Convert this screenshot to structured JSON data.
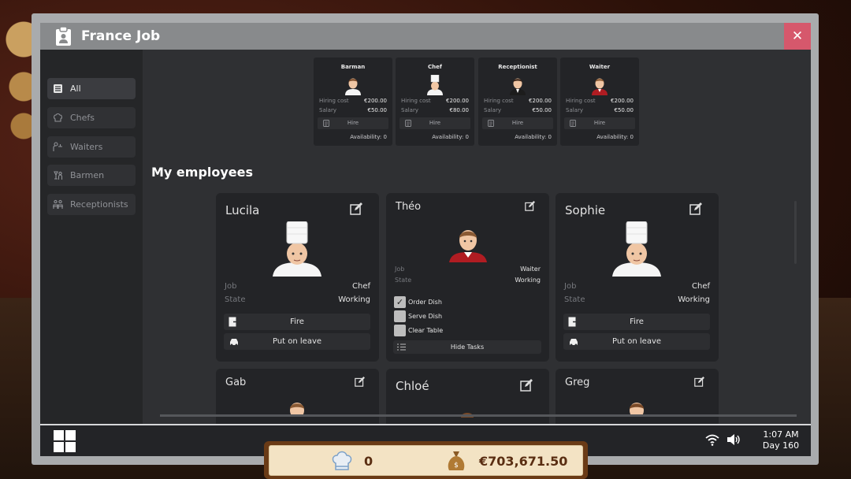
{
  "window": {
    "title": "France Job",
    "close": "✕"
  },
  "sidebar": {
    "items": [
      {
        "label": "All",
        "active": true
      },
      {
        "label": "Chefs"
      },
      {
        "label": "Waiters"
      },
      {
        "label": "Barmen"
      },
      {
        "label": "Receptionists"
      }
    ]
  },
  "jobs": [
    {
      "title": "Barman",
      "hiring_label": "Hiring cost",
      "hiring_cost": "€200.00",
      "salary_label": "Salary",
      "salary": "€50.00",
      "hire": "Hire",
      "availability_label": "Availability:",
      "availability": "0"
    },
    {
      "title": "Chef",
      "hiring_label": "Hiring cost",
      "hiring_cost": "€200.00",
      "salary_label": "Salary",
      "salary": "€80.00",
      "hire": "Hire",
      "availability_label": "Availability:",
      "availability": "0"
    },
    {
      "title": "Receptionist",
      "hiring_label": "Hiring cost",
      "hiring_cost": "€200.00",
      "salary_label": "Salary",
      "salary": "€50.00",
      "hire": "Hire",
      "availability_label": "Availability:",
      "availability": "0"
    },
    {
      "title": "Waiter",
      "hiring_label": "Hiring cost",
      "hiring_cost": "€200.00",
      "salary_label": "Salary",
      "salary": "€50.00",
      "hire": "Hire",
      "availability_label": "Availability:",
      "availability": "0"
    }
  ],
  "employees_title": "My employees",
  "employees": [
    {
      "name": "Lucila",
      "job_label": "Job",
      "job": "Chef",
      "state_label": "State",
      "state": "Working",
      "fire": "Fire",
      "leave": "Put on leave"
    },
    {
      "name": "Théo",
      "job_label": "Job",
      "job": "Waiter",
      "state_label": "State",
      "state": "Working",
      "tasks": [
        "Order Dish",
        "Serve Dish",
        "Clear Table"
      ],
      "hide_tasks": "Hide Tasks"
    },
    {
      "name": "Sophie",
      "job_label": "Job",
      "job": "Chef",
      "state_label": "State",
      "state": "Working",
      "fire": "Fire",
      "leave": "Put on leave"
    },
    {
      "name": "Gab"
    },
    {
      "name": "Chloé"
    },
    {
      "name": "Greg"
    }
  ],
  "taskbar": {
    "time": "1:07 AM",
    "day": "Day 160"
  },
  "resources": {
    "chefs": "0",
    "money": "€703,671.50"
  },
  "colors": {
    "close": "#d6586c",
    "panel": "#2f3033",
    "card": "#232427",
    "sidebar": "#252628",
    "money_bar": "#6a3b16"
  }
}
